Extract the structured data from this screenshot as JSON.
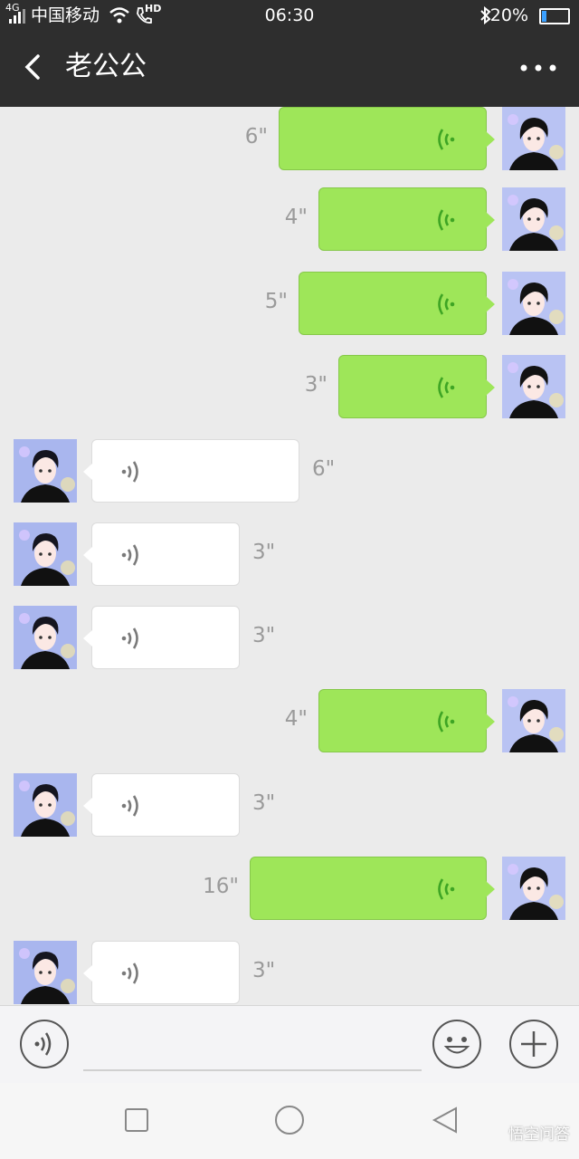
{
  "status_bar": {
    "network": "4G",
    "carrier": "中国移动",
    "hd": "HD",
    "time": "06:30",
    "battery": "20%",
    "battery_level": 0.2
  },
  "header": {
    "title": "老公公",
    "back_icon": "chevron-left-icon",
    "more_icon": "more-dots-icon"
  },
  "messages": [
    {
      "side": "sent",
      "duration": "6\""
    },
    {
      "side": "sent",
      "duration": "4\""
    },
    {
      "side": "sent",
      "duration": "5\""
    },
    {
      "side": "sent",
      "duration": "3\""
    },
    {
      "side": "recv",
      "duration": "6\""
    },
    {
      "side": "recv",
      "duration": "3\""
    },
    {
      "side": "recv",
      "duration": "3\""
    },
    {
      "side": "sent",
      "duration": "4\""
    },
    {
      "side": "recv",
      "duration": "3\""
    },
    {
      "side": "sent",
      "duration": "16\""
    },
    {
      "side": "recv",
      "duration": "3\""
    }
  ],
  "input_bar": {
    "voice_icon": "voice-icon",
    "input_value": "",
    "emoji_icon": "smiley-icon",
    "plus_icon": "plus-icon"
  },
  "system_nav": {
    "watermark": "悟空问答"
  },
  "colors": {
    "header_bg": "#2e2e2e",
    "chat_bg": "#ebebeb",
    "sent_bubble": "#9ee659",
    "recv_bubble": "#ffffff",
    "sent_wave": "#3ea524",
    "recv_wave": "#7a7a7a"
  }
}
